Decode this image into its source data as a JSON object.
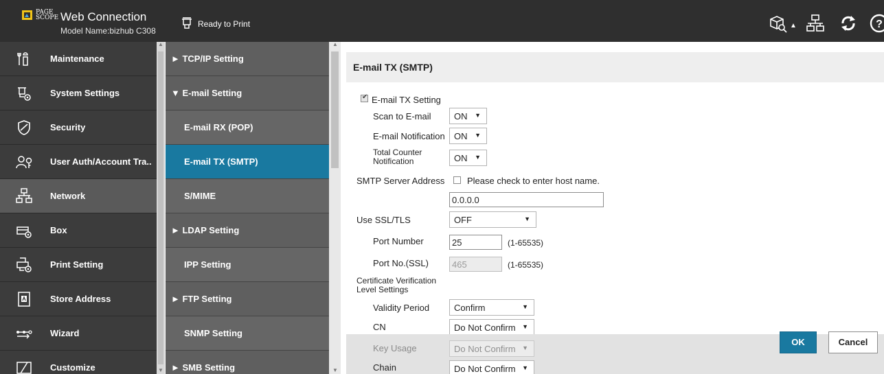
{
  "header": {
    "brand_page": "PAGE\nSCOPE",
    "brand_title": "Web Connection",
    "model_name": "Model Name:bizhub C308",
    "status": "Ready to Print",
    "icons": [
      "model-search-icon",
      "network-map-icon",
      "refresh-icon",
      "help-icon"
    ]
  },
  "sidebar": {
    "items": [
      {
        "label": "Maintenance",
        "icon": "maintenance-icon"
      },
      {
        "label": "System Settings",
        "icon": "system-settings-icon"
      },
      {
        "label": "Security",
        "icon": "security-icon"
      },
      {
        "label": "User Auth/Account Tra..",
        "icon": "user-auth-icon"
      },
      {
        "label": "Network",
        "icon": "network-icon",
        "active": true
      },
      {
        "label": "Box",
        "icon": "box-icon"
      },
      {
        "label": "Print Setting",
        "icon": "print-setting-icon"
      },
      {
        "label": "Store Address",
        "icon": "store-address-icon"
      },
      {
        "label": "Wizard",
        "icon": "wizard-icon"
      },
      {
        "label": "Customize",
        "icon": "customize-icon"
      }
    ]
  },
  "subnav": {
    "items": [
      {
        "label": "► TCP/IP Setting",
        "kind": "group"
      },
      {
        "label": "▼ E-mail Setting",
        "kind": "group"
      },
      {
        "label": "E-mail RX (POP)",
        "kind": "child"
      },
      {
        "label": "E-mail TX (SMTP)",
        "kind": "child",
        "selected": true
      },
      {
        "label": "S/MIME",
        "kind": "child"
      },
      {
        "label": "► LDAP Setting",
        "kind": "group"
      },
      {
        "label": "IPP Setting",
        "kind": "child"
      },
      {
        "label": "► FTP Setting",
        "kind": "group"
      },
      {
        "label": "SNMP Setting",
        "kind": "child"
      },
      {
        "label": "► SMB Setting",
        "kind": "group"
      }
    ]
  },
  "main": {
    "title": "E-mail TX (SMTP)",
    "email_tx_setting": {
      "label": "E-mail TX Setting",
      "checked": true
    },
    "scan_to_email": {
      "label": "Scan to E-mail",
      "value": "ON"
    },
    "email_notification": {
      "label": "E-mail Notification",
      "value": "ON"
    },
    "total_counter_notification": {
      "label": "Total Counter\nNotification",
      "value": "ON"
    },
    "smtp_server_address": {
      "label": "SMTP Server Address",
      "check_label": "Please check to enter host name.",
      "checked": false,
      "value": "0.0.0.0"
    },
    "use_ssl_tls": {
      "label": "Use SSL/TLS",
      "value": "OFF"
    },
    "port_number": {
      "label": "Port Number",
      "value": "25",
      "range": "(1-65535)"
    },
    "port_ssl": {
      "label": "Port No.(SSL)",
      "value": "465",
      "range": "(1-65535)"
    },
    "cert_heading": "Certificate Verification\nLevel Settings",
    "validity_period": {
      "label": "Validity Period",
      "value": "Confirm"
    },
    "cn": {
      "label": "CN",
      "value": "Do Not Confirm"
    },
    "key_usage": {
      "label": "Key Usage",
      "value": "Do Not Confirm"
    },
    "chain": {
      "label": "Chain",
      "value": "Do Not Confirm"
    },
    "ok_label": "OK",
    "cancel_label": "Cancel"
  },
  "colors": {
    "header_bg": "#2f2f2f",
    "sidebar_bg": "#3c3c3c",
    "subnav_bg": "#555555",
    "accent": "#1979a0"
  }
}
